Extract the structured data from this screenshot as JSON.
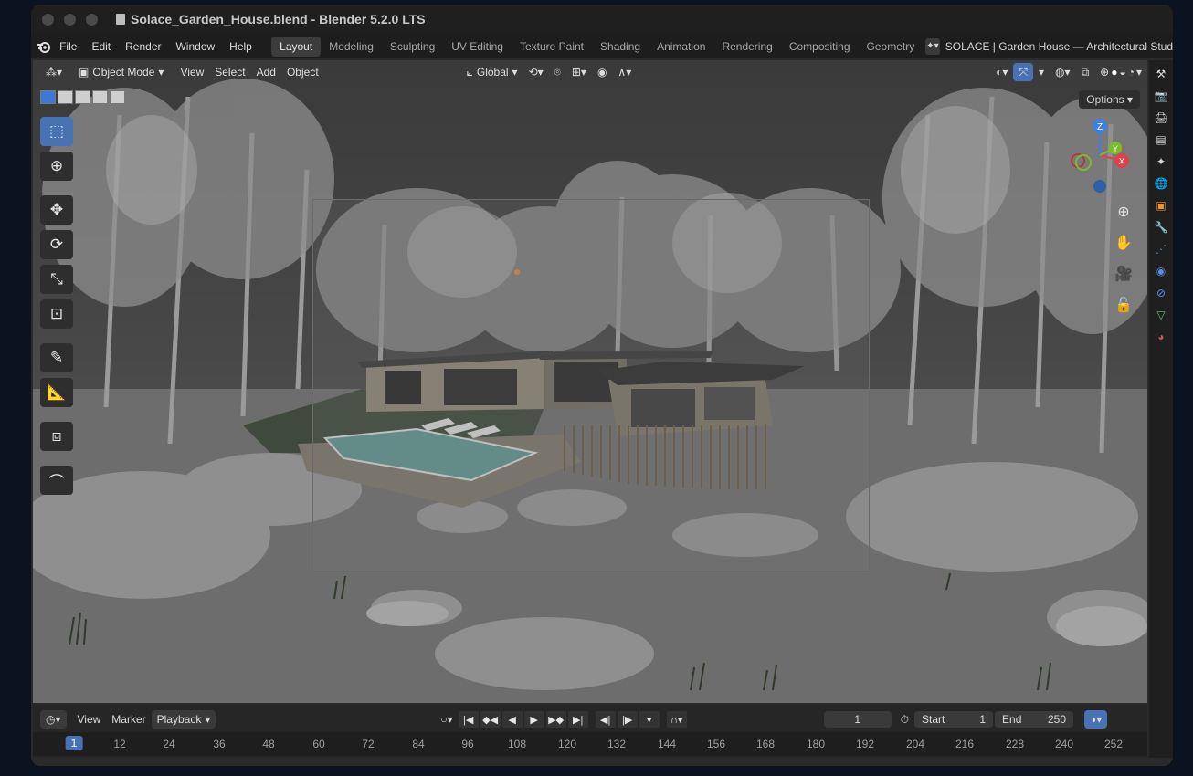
{
  "window": {
    "title": "Solace_Garden_House.blend - Blender 5.2.0 LTS"
  },
  "menu": {
    "items": [
      "File",
      "Edit",
      "Render",
      "Window",
      "Help"
    ]
  },
  "workspaces": {
    "tabs": [
      "Layout",
      "Modeling",
      "Sculpting",
      "UV Editing",
      "Texture Paint",
      "Shading",
      "Animation",
      "Rendering",
      "Compositing",
      "Geometry"
    ],
    "active": "Layout"
  },
  "scene": {
    "name": "SOLACE | Garden House — Architectural Stud"
  },
  "viewport": {
    "mode": "Object Mode",
    "menus": [
      "View",
      "Select",
      "Add",
      "Object"
    ],
    "transform_orientation": "Global",
    "options_label": "Options",
    "gizmo": {
      "x": "X",
      "y": "Y",
      "z": "Z"
    },
    "axis_colors": {
      "x": "#e0404a",
      "y": "#7dbb2b",
      "z": "#3e7fe0"
    }
  },
  "timeline": {
    "menus": [
      "View",
      "Marker",
      "Playback"
    ],
    "current_frame": "1",
    "start_label": "Start",
    "start_value": "1",
    "end_label": "End",
    "end_value": "250",
    "ticks": [
      "1",
      "12",
      "24",
      "36",
      "48",
      "60",
      "72",
      "84",
      "96",
      "108",
      "120",
      "132",
      "144",
      "156",
      "168",
      "180",
      "192",
      "204",
      "216",
      "228",
      "240",
      "252"
    ]
  },
  "colors": {
    "accent": "#4772b3",
    "header_bg": "#1d1d1d",
    "viewport_bg": "#4a4a4a"
  }
}
